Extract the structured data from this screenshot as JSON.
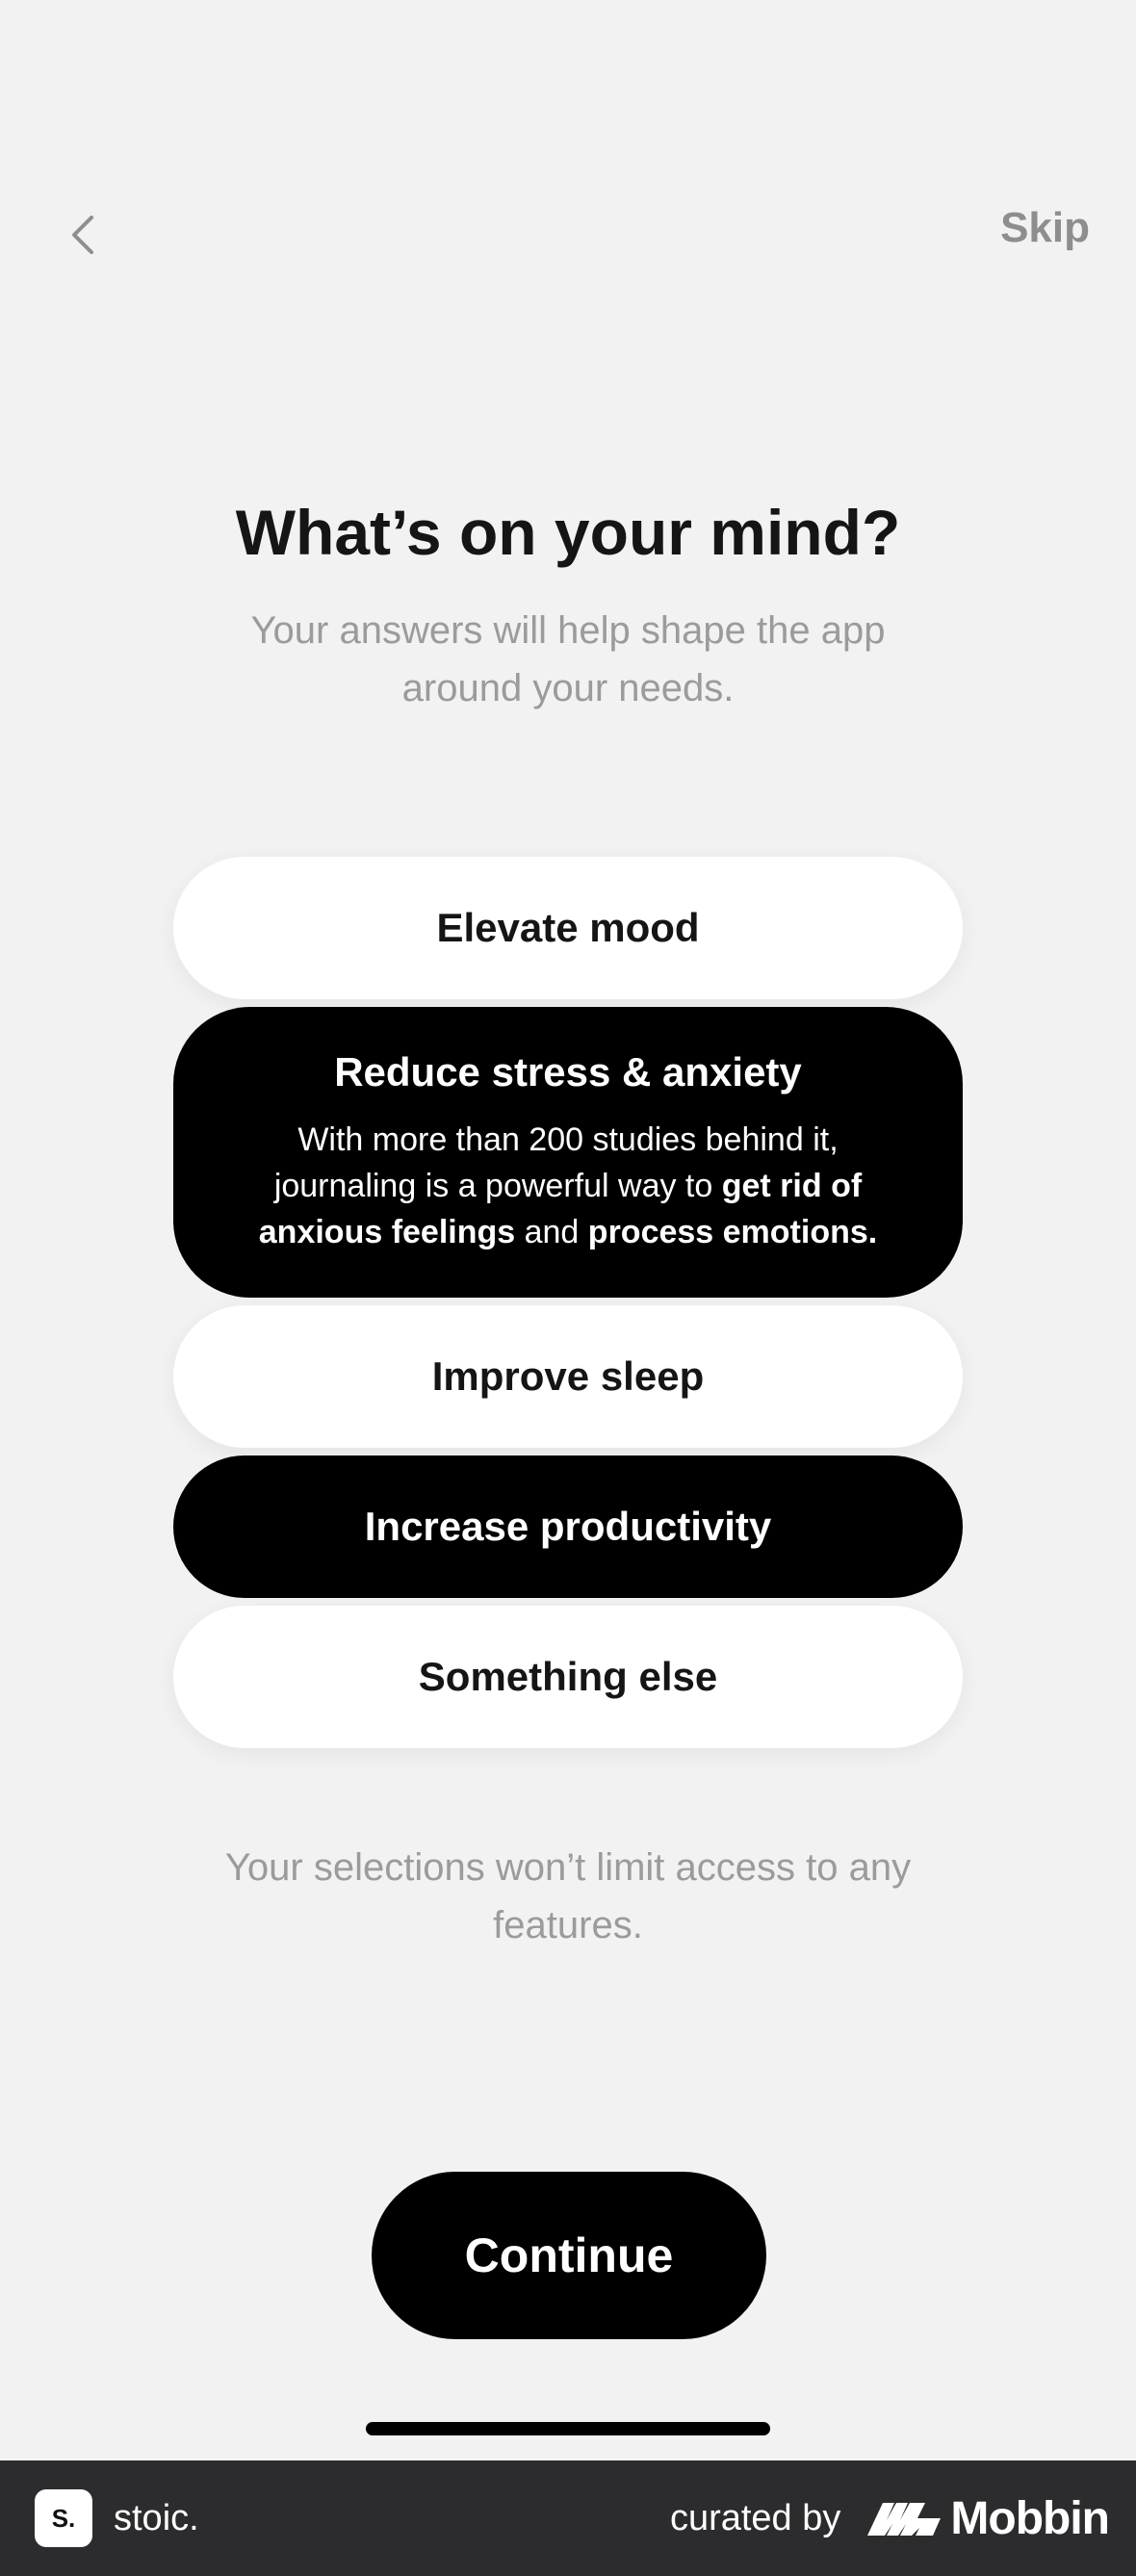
{
  "header": {
    "back_icon": "chevron-left-icon",
    "skip_label": "Skip"
  },
  "title": "What’s on your mind?",
  "subtitle": "Your answers will help shape the app around your needs.",
  "options": [
    {
      "label": "Elevate mood",
      "selected": false
    },
    {
      "label": "Reduce stress & anxiety",
      "selected": true,
      "description": {
        "p1": "With more than 200 studies behind it, journaling is a powerful way to ",
        "b1": "get rid of anxious feelings",
        "p2": " and ",
        "b2": "process emotions."
      }
    },
    {
      "label": "Improve sleep",
      "selected": false
    },
    {
      "label": "Increase productivity",
      "selected": true
    },
    {
      "label": "Something else",
      "selected": false
    }
  ],
  "footnote": "Your selections won’t limit access to any features.",
  "continue_label": "Continue",
  "footer": {
    "app_logo_text": "S.",
    "app_name": "stoic.",
    "curated_by": "curated by",
    "mobbin_label": "Mobbin"
  },
  "colors": {
    "background": "#f2f2f3",
    "selected": "#000000",
    "unselected": "#ffffff",
    "muted_text": "#9b9b9d",
    "footer_bg": "#2c2c2e"
  }
}
